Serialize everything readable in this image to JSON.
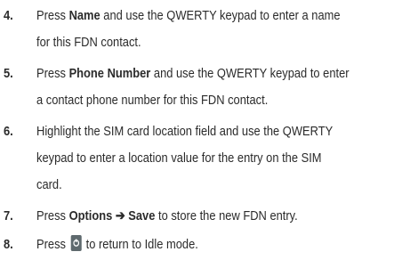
{
  "steps": [
    {
      "number": "4.",
      "lines": [
        {
          "pre": "Press ",
          "bold": "Name",
          "post": " and use the QWERTY keypad to enter a name"
        },
        {
          "text": "for this FDN contact."
        }
      ]
    },
    {
      "number": "5.",
      "lines": [
        {
          "pre": "Press ",
          "bold": "Phone Number",
          "post": " and use the QWERTY keypad to enter"
        },
        {
          "text": "a contact phone number for this FDN contact."
        }
      ]
    },
    {
      "number": "6.",
      "lines": [
        {
          "text": "Highlight the SIM card location field and use the QWERTY"
        },
        {
          "text": "keypad to enter a location value for the entry on the SIM"
        },
        {
          "text": "card."
        }
      ]
    },
    {
      "number": "7.",
      "lines": [
        {
          "pre": "Press ",
          "bold": "Options ➔ Save",
          "post": " to store the new FDN entry."
        }
      ]
    },
    {
      "number": "8.",
      "lines": [
        {
          "pre": "Press ",
          "icon": "end-key-icon",
          "post": " to return to Idle mode."
        }
      ]
    }
  ],
  "colors": {
    "text": "#2b2b2b",
    "key_icon": "#5f6a6e"
  }
}
